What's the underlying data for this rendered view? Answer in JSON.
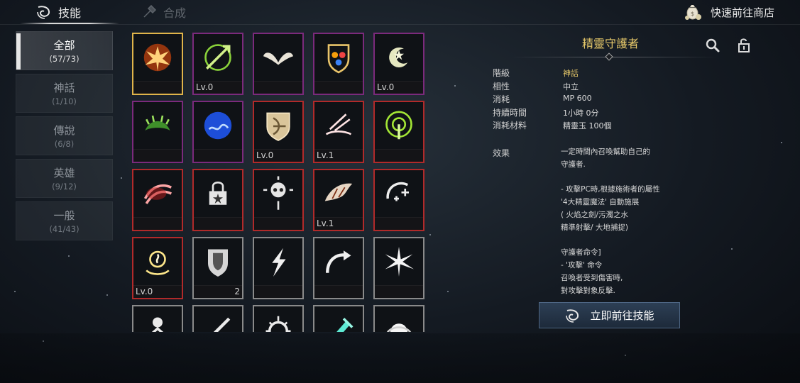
{
  "tabs": [
    {
      "label": "技能",
      "icon": "swirl-icon",
      "active": true
    },
    {
      "label": "合成",
      "icon": "hammer-icon",
      "active": false
    }
  ],
  "shop": {
    "label": "快速前往商店",
    "icon": "money-bag-icon"
  },
  "categories": [
    {
      "name": "全部",
      "count": "(57/73)",
      "active": true
    },
    {
      "name": "神話",
      "count": "(1/10)"
    },
    {
      "name": "傳說",
      "count": "(6/8)"
    },
    {
      "name": "英雄",
      "count": "(9/12)"
    },
    {
      "name": "一般",
      "count": "(41/43)"
    }
  ],
  "colors": {
    "mythic_border": "#7b2a7c",
    "legendary_border": "#b12a2a",
    "general_border": "#8a8a8a",
    "selected_border": "#e0b44a",
    "title_gold": "#e7c96a"
  },
  "skills": [
    {
      "rarity": "sel",
      "icon": "phoenix-icon",
      "level": "",
      "count": ""
    },
    {
      "rarity": "myth",
      "icon": "arrow-target-icon",
      "level": "Lv.0",
      "count": ""
    },
    {
      "rarity": "myth",
      "icon": "wings-icon",
      "level": "",
      "count": ""
    },
    {
      "rarity": "myth",
      "icon": "elemental-shield-icon",
      "level": "",
      "count": ""
    },
    {
      "rarity": "myth",
      "icon": "moon-star-icon",
      "level": "Lv.0",
      "count": ""
    },
    {
      "rarity": "myth",
      "icon": "thorn-vine-icon",
      "level": "",
      "count": ""
    },
    {
      "rarity": "myth",
      "icon": "water-orb-icon",
      "level": "",
      "count": ""
    },
    {
      "rarity": "leg",
      "icon": "bow-shield-icon",
      "level": "Lv.0",
      "count": ""
    },
    {
      "rarity": "leg",
      "icon": "arrow-storm-icon",
      "level": "Lv.1",
      "count": ""
    },
    {
      "rarity": "leg",
      "icon": "radar-arrow-icon",
      "level": "",
      "count": ""
    },
    {
      "rarity": "leg",
      "icon": "claw-slash-icon",
      "level": "",
      "count": ""
    },
    {
      "rarity": "leg",
      "icon": "star-lock-icon",
      "level": "",
      "count": ""
    },
    {
      "rarity": "leg",
      "icon": "crosshair-skull-icon",
      "level": "",
      "count": ""
    },
    {
      "rarity": "leg",
      "icon": "dragon-wing-icon",
      "level": "Lv.1",
      "count": ""
    },
    {
      "rarity": "leg",
      "icon": "plus-buff-icon",
      "level": "",
      "count": ""
    },
    {
      "rarity": "leg",
      "icon": "spirit-summon-icon",
      "level": "Lv.0",
      "count": ""
    },
    {
      "rarity": "gen",
      "icon": "shield-icon",
      "level": "",
      "count": "2"
    },
    {
      "rarity": "gen",
      "icon": "lightning-icon",
      "level": "",
      "count": ""
    },
    {
      "rarity": "gen",
      "icon": "curved-arrow-icon",
      "level": "",
      "count": ""
    },
    {
      "rarity": "gen",
      "icon": "burst-icon",
      "level": "",
      "count": ""
    },
    {
      "rarity": "gen",
      "icon": "figure-icon",
      "level": "",
      "count": ""
    },
    {
      "rarity": "gen",
      "icon": "slash-icon",
      "level": "",
      "count": ""
    },
    {
      "rarity": "gen",
      "icon": "gear-sun-icon",
      "level": "",
      "count": ""
    },
    {
      "rarity": "gen",
      "icon": "crystal-sword-icon",
      "level": "",
      "count": ""
    },
    {
      "rarity": "gen",
      "icon": "orb-icon",
      "level": "",
      "count": ""
    }
  ],
  "detail": {
    "title": "精靈守護者",
    "search_icon": "magnifier-icon",
    "lock_icon": "unlock-icon",
    "attrs": [
      {
        "label": "階級",
        "value": "神話",
        "gold": true
      },
      {
        "label": "相性",
        "value": "中立"
      },
      {
        "label": "消耗",
        "value": "MP 600"
      },
      {
        "label": "持續時間",
        "value": "1小時 0分"
      },
      {
        "label": "消耗材料",
        "value": "精靈玉 100個"
      }
    ],
    "effect_label": "效果",
    "effect_lines": [
      "一定時間內召喚幫助自己的",
      "守護者.",
      "",
      "- 攻擊PC時,根據施術者的屬性",
      "'4大精靈魔法' 自動施展",
      "( 火焰之劍/污濁之水",
      "精準射擊/ 大地捕捉)",
      "",
      "守護者命令]",
      "- '攻擊' 命令",
      "召喚者受到傷害時,",
      "對攻擊對象反擊."
    ]
  },
  "go_button": {
    "label": "立即前往技能",
    "icon": "swirl-icon"
  }
}
